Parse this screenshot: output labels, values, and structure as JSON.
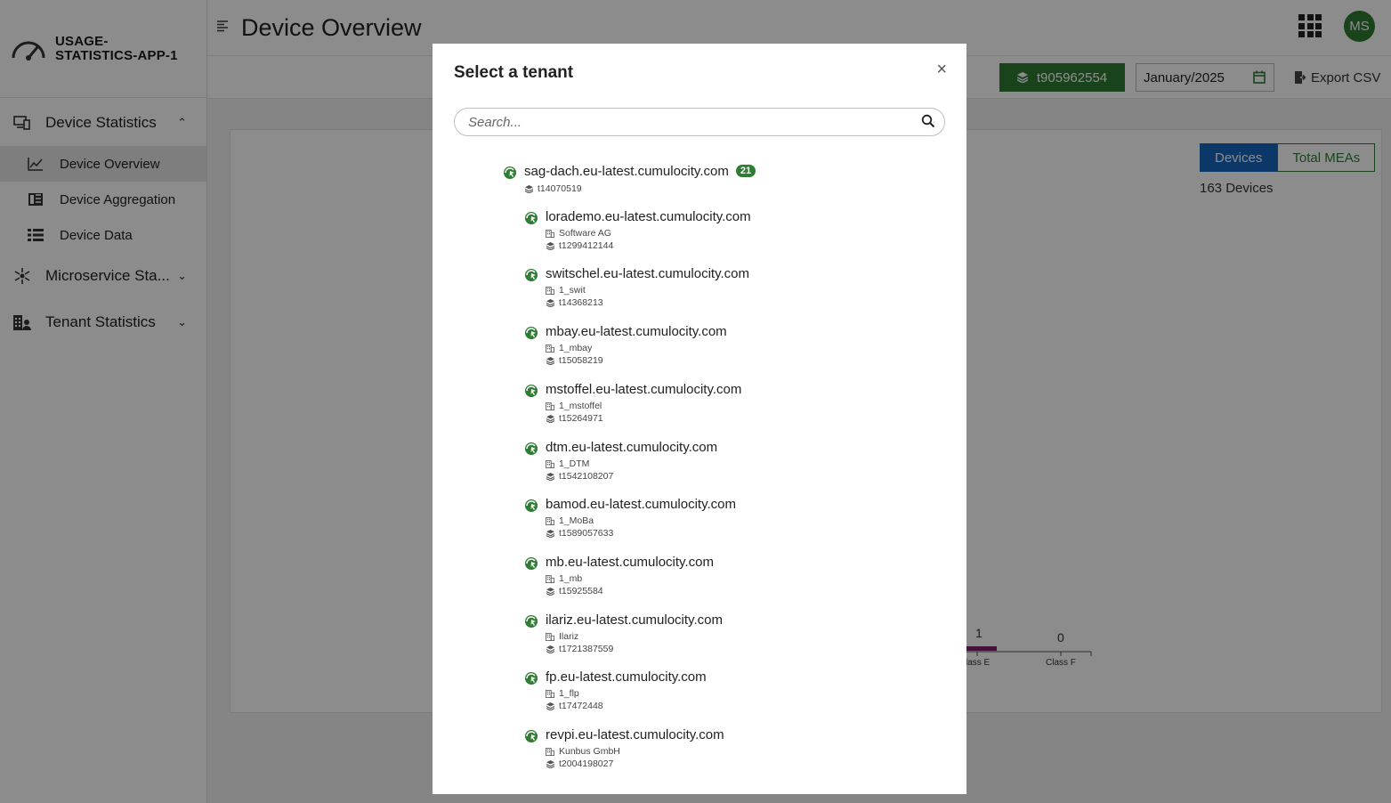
{
  "app": {
    "name_line1": "USAGE-",
    "name_line2": "STATISTICS-APP-1"
  },
  "sidebar": {
    "groups": [
      {
        "label": "Device Statistics",
        "expanded": true
      },
      {
        "label": "Microservice Sta...",
        "expanded": false
      },
      {
        "label": "Tenant Statistics",
        "expanded": false
      }
    ],
    "items": [
      {
        "label": "Device Overview",
        "active": true
      },
      {
        "label": "Device Aggregation"
      },
      {
        "label": "Device Data"
      }
    ]
  },
  "header": {
    "title": "Device Overview",
    "avatar_initials": "MS"
  },
  "toolbar": {
    "tenant_button": "t905962554",
    "date_value": "January/2025",
    "export_label": "Export CSV"
  },
  "content": {
    "toggle": {
      "devices": "Devices",
      "total_meas": "Total MEAs"
    },
    "device_count": "163 Devices",
    "chart_fragment": {
      "value_e": "1",
      "label_e": "lass E",
      "value_f": "0",
      "label_f": "Class F"
    }
  },
  "modal": {
    "title": "Select a tenant",
    "close": "×",
    "search_placeholder": "Search...",
    "parent": {
      "domain": "sag-dach.eu-latest.cumulocity.com",
      "badge": "21",
      "id": "t14070519"
    },
    "children": [
      {
        "domain": "lorademo.eu-latest.cumulocity.com",
        "company": "Software AG",
        "id": "t1299412144"
      },
      {
        "domain": "switschel.eu-latest.cumulocity.com",
        "company": "1_swit",
        "id": "t14368213"
      },
      {
        "domain": "mbay.eu-latest.cumulocity.com",
        "company": "1_mbay",
        "id": "t15058219"
      },
      {
        "domain": "mstoffel.eu-latest.cumulocity.com",
        "company": "1_mstoffel",
        "id": "t15264971"
      },
      {
        "domain": "dtm.eu-latest.cumulocity.com",
        "company": "1_DTM",
        "id": "t1542108207"
      },
      {
        "domain": "bamod.eu-latest.cumulocity.com",
        "company": "1_MoBa",
        "id": "t1589057633"
      },
      {
        "domain": "mb.eu-latest.cumulocity.com",
        "company": "1_mb",
        "id": "t15925584"
      },
      {
        "domain": "ilariz.eu-latest.cumulocity.com",
        "company": "Ilariz",
        "id": "t1721387559"
      },
      {
        "domain": "fp.eu-latest.cumulocity.com",
        "company": "1_flp",
        "id": "t17472448"
      },
      {
        "domain": "revpi.eu-latest.cumulocity.com",
        "company": "Kunbus GmbH",
        "id": "t2004198027"
      }
    ]
  },
  "colors": {
    "primary_green": "#2e7d32",
    "active_blue": "#1565c0",
    "overlay": "rgba(0,0,0,0.45)"
  }
}
